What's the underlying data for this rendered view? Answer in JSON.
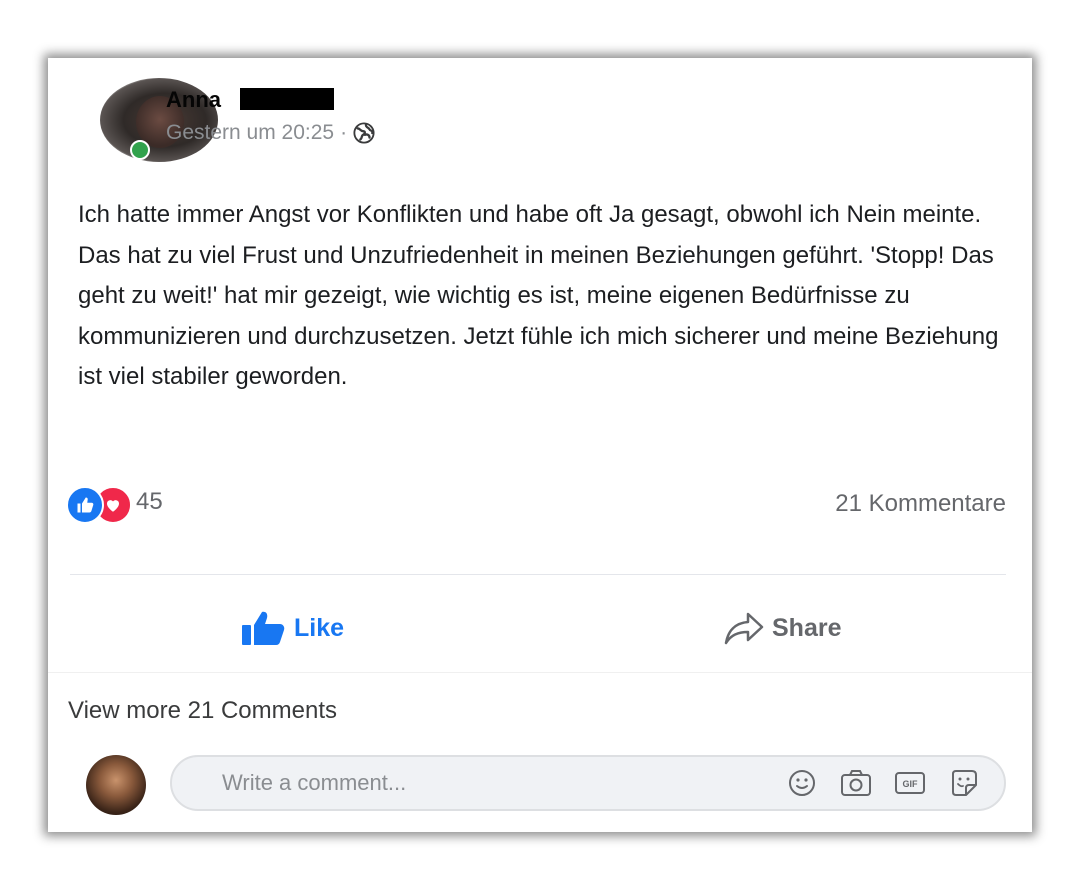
{
  "post": {
    "author_name": "Anna",
    "timestamp": "Gestern um 20:25",
    "separator": "·",
    "privacy_icon": "globe-icon",
    "text": "Ich hatte immer Angst vor Konflikten und habe oft Ja gesagt, obwohl ich Nein meinte. Das hat zu viel Frust und Unzufriedenheit in meinen Beziehungen geführt. 'Stopp! Das geht zu weit!' hat mir gezeigt, wie wichtig es ist, meine eigenen Bedürfnisse zu kommunizieren und durchzusetzen. Jetzt fühle ich mich sicherer und meine Beziehung ist viel stabiler geworden."
  },
  "reactions": {
    "icons": [
      "like-icon",
      "love-icon"
    ],
    "count": "45",
    "comments_label": "21 Kommentare"
  },
  "actions": {
    "like_label": "Like",
    "share_label": "Share"
  },
  "comments": {
    "view_more_label": "View more 21 Comments",
    "input_placeholder": "Write a comment...",
    "tools": [
      "emoji-icon",
      "camera-icon",
      "gif-icon",
      "sticker-icon"
    ]
  },
  "colors": {
    "brand_blue": "#1877f2",
    "love_red": "#f0284a",
    "online_green": "#31a24c",
    "muted_text": "#65676b"
  }
}
